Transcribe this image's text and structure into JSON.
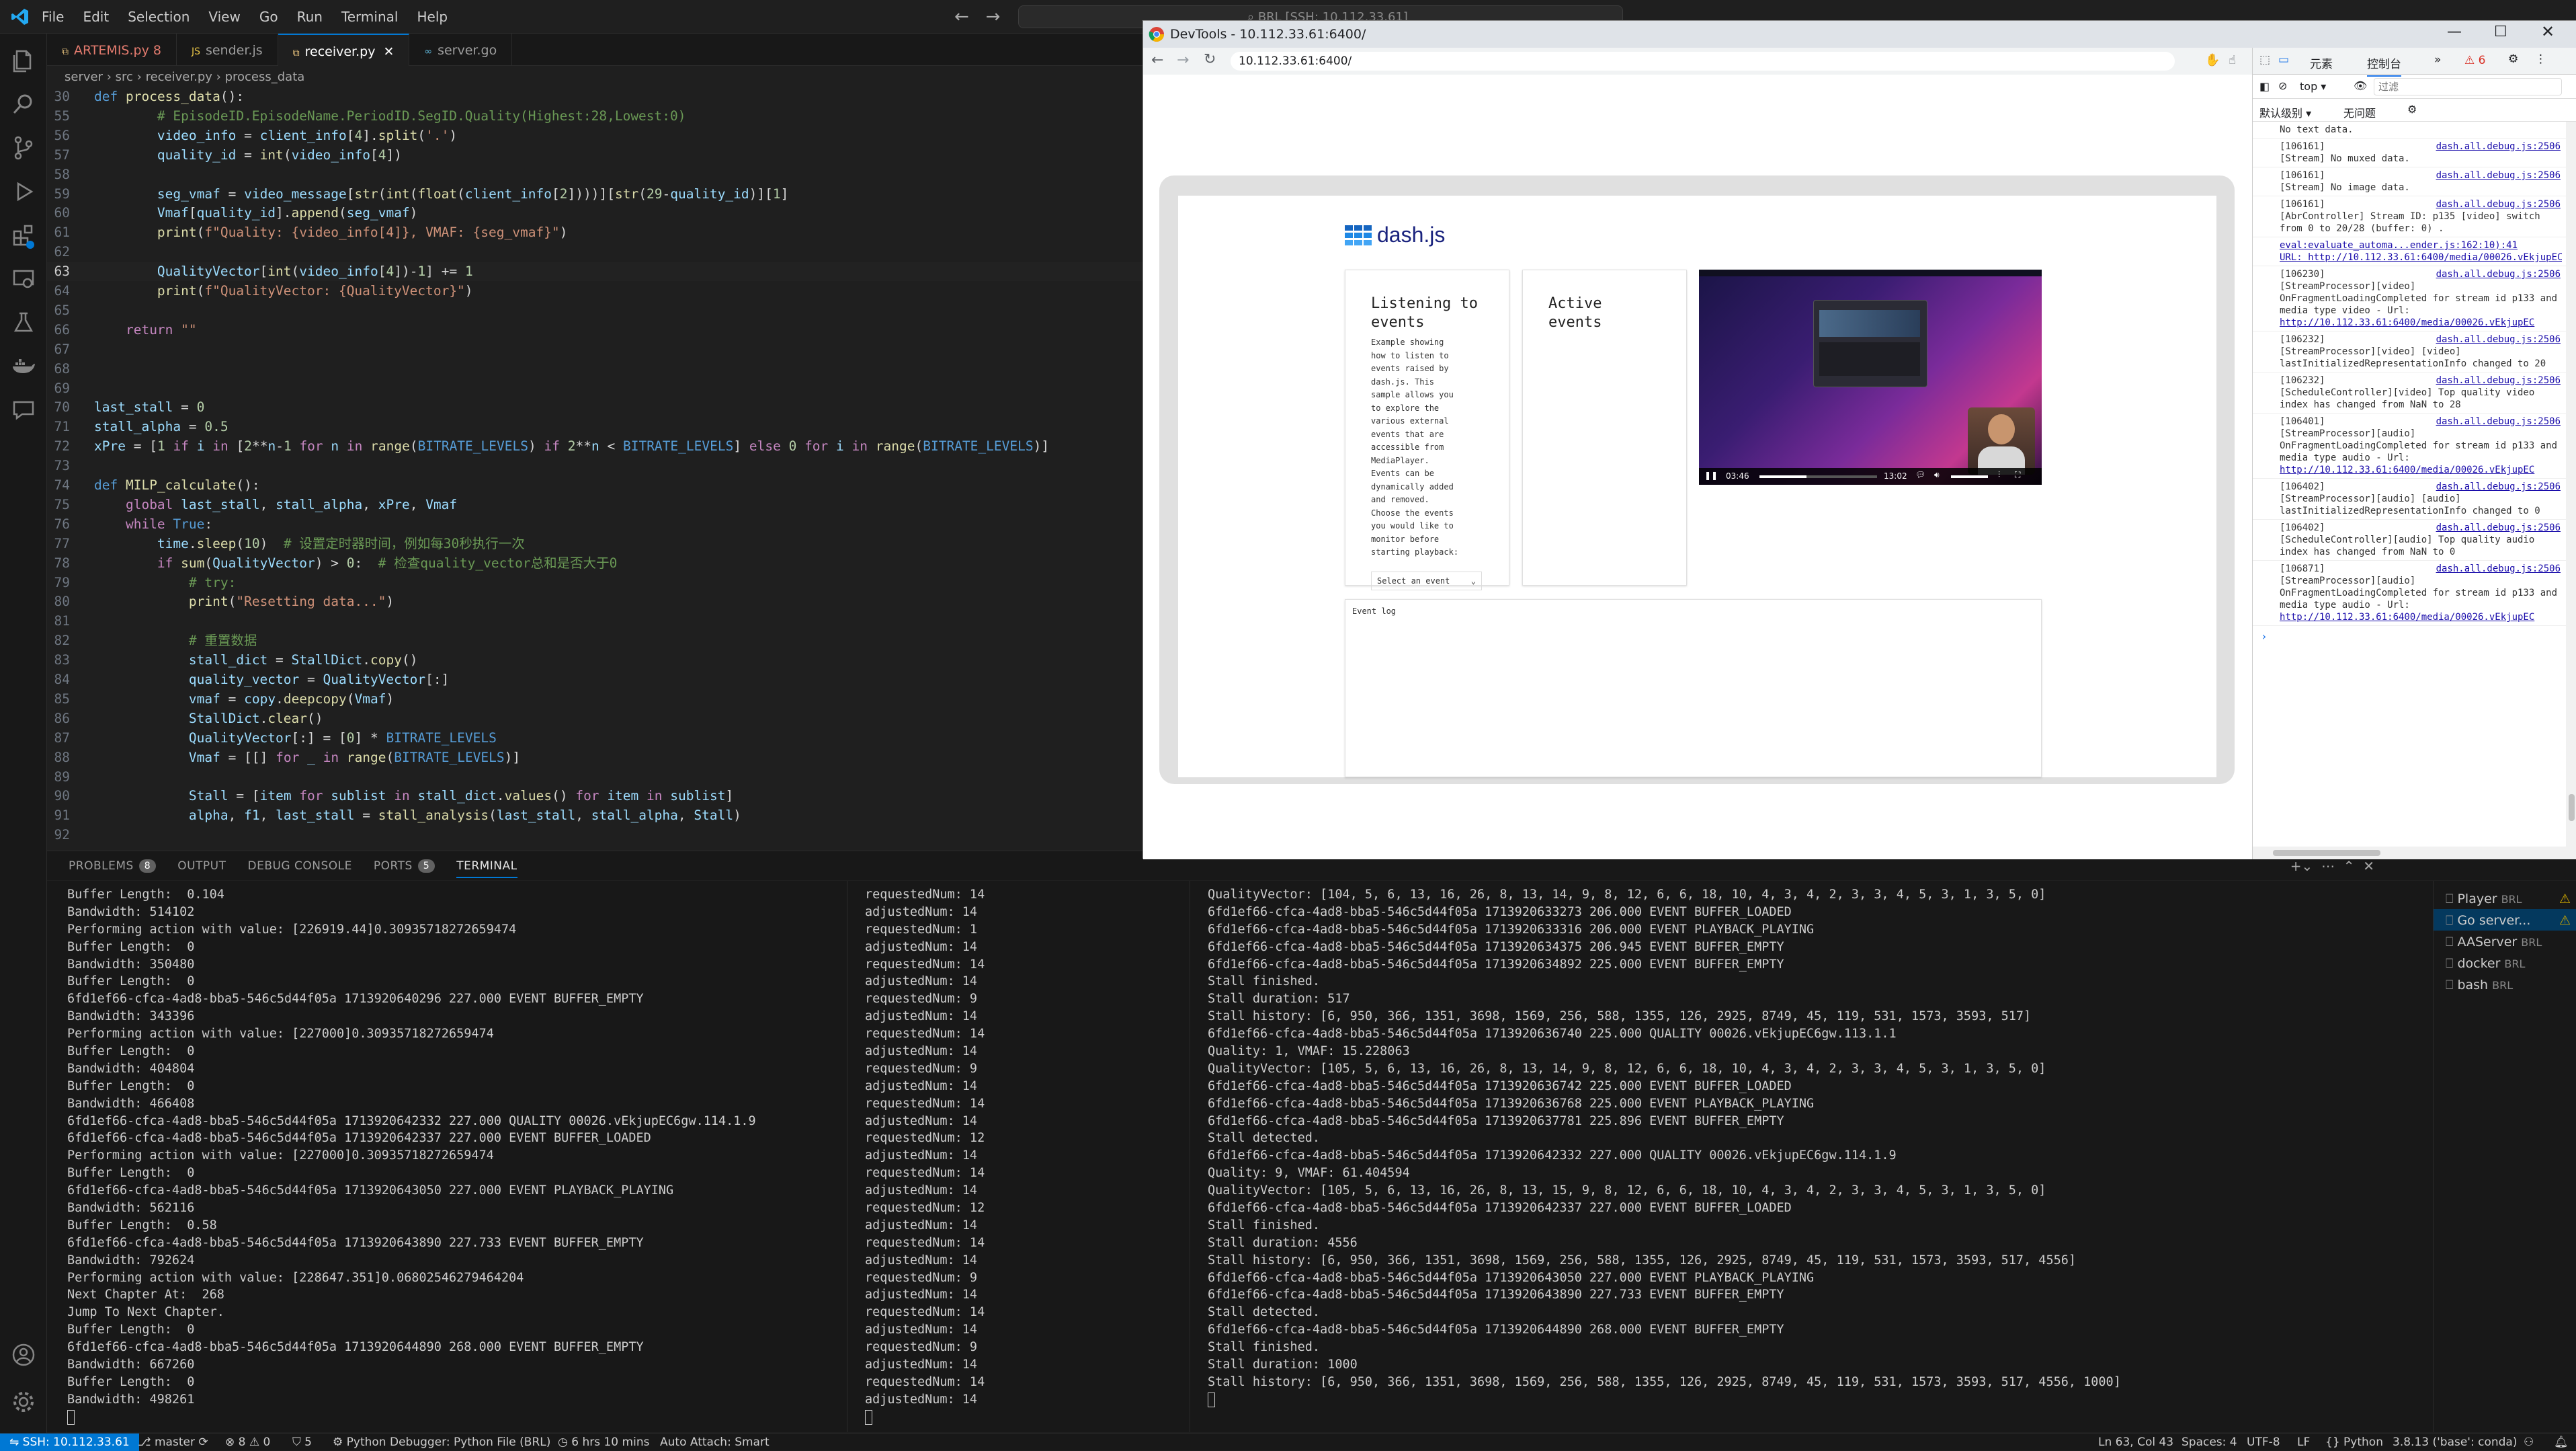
{
  "vscode": {
    "menu": [
      "File",
      "Edit",
      "Selection",
      "View",
      "Go",
      "Run",
      "Terminal",
      "Help"
    ],
    "command_center": "BRL [SSH: 10.112.33.61]",
    "tabs": [
      {
        "label": "ARTEMIS.py",
        "badge": "8",
        "icon": "python-icon"
      },
      {
        "label": "sender.js",
        "badge": "",
        "icon": "js-icon"
      },
      {
        "label": "receiver.py",
        "badge": "",
        "icon": "python-icon",
        "active": true
      },
      {
        "label": "server.go",
        "badge": "",
        "icon": "go-icon"
      }
    ],
    "breadcrumb": [
      "server",
      "src",
      "receiver.py",
      "process_data"
    ],
    "code": [
      {
        "ln": "30",
        "t": "def process_data():"
      },
      {
        "ln": "55",
        "t": "        # EpisodeID.EpisodeName.PeriodID.SegID.Quality(Highest:28,Lowest:0)"
      },
      {
        "ln": "56",
        "t": "        video_info = client_info[4].split('.')"
      },
      {
        "ln": "57",
        "t": "        quality_id = int(video_info[4])"
      },
      {
        "ln": "58",
        "t": ""
      },
      {
        "ln": "59",
        "t": "        seg_vmaf = video_message[str(int(float(client_info[2])))][str(29-quality_id)][1]"
      },
      {
        "ln": "60",
        "t": "        Vmaf[quality_id].append(seg_vmaf)"
      },
      {
        "ln": "61",
        "t": "        print(f\"Quality: {video_info[4]}, VMAF: {seg_vmaf}\")"
      },
      {
        "ln": "62",
        "t": ""
      },
      {
        "ln": "63",
        "t": "        QualityVector[int(video_info[4])-1] += 1"
      },
      {
        "ln": "64",
        "t": "        print(f\"QualityVector: {QualityVector}\")"
      },
      {
        "ln": "65",
        "t": ""
      },
      {
        "ln": "66",
        "t": "    return \"\""
      },
      {
        "ln": "67",
        "t": ""
      },
      {
        "ln": "68",
        "t": ""
      },
      {
        "ln": "69",
        "t": ""
      },
      {
        "ln": "70",
        "t": "last_stall = 0"
      },
      {
        "ln": "71",
        "t": "stall_alpha = 0.5"
      },
      {
        "ln": "72",
        "t": "xPre = [1 if i in [2**n-1 for n in range(BITRATE_LEVELS) if 2**n < BITRATE_LEVELS] else 0 for i in range(BITRATE_LEVELS)]"
      },
      {
        "ln": "73",
        "t": ""
      },
      {
        "ln": "74",
        "t": "def MILP_calculate():"
      },
      {
        "ln": "75",
        "t": "    global last_stall, stall_alpha, xPre, Vmaf"
      },
      {
        "ln": "76",
        "t": "    while True:"
      },
      {
        "ln": "77",
        "t": "        time.sleep(10)  # 设置定时器时间，例如每30秒执行一次"
      },
      {
        "ln": "78",
        "t": "        if sum(QualityVector) > 0:  # 检查quality_vector总和是否大于0"
      },
      {
        "ln": "79",
        "t": "            # try:"
      },
      {
        "ln": "80",
        "t": "            print(\"Resetting data...\")"
      },
      {
        "ln": "81",
        "t": ""
      },
      {
        "ln": "82",
        "t": "            # 重置数据"
      },
      {
        "ln": "83",
        "t": "            stall_dict = StallDict.copy()"
      },
      {
        "ln": "84",
        "t": "            quality_vector = QualityVector[:]"
      },
      {
        "ln": "85",
        "t": "            vmaf = copy.deepcopy(Vmaf)"
      },
      {
        "ln": "86",
        "t": "            StallDict.clear()"
      },
      {
        "ln": "87",
        "t": "            QualityVector[:] = [0] * BITRATE_LEVELS"
      },
      {
        "ln": "88",
        "t": "            Vmaf = [[] for _ in range(BITRATE_LEVELS)]"
      },
      {
        "ln": "89",
        "t": ""
      },
      {
        "ln": "90",
        "t": "            Stall = [item for sublist in stall_dict.values() for item in sublist]"
      },
      {
        "ln": "91",
        "t": "            alpha, f1, last_stall = stall_analysis(last_stall, stall_alpha, Stall)"
      },
      {
        "ln": "92",
        "t": ""
      }
    ],
    "cursor_line": "63",
    "panel_tabs": [
      {
        "label": "PROBLEMS",
        "count": "8"
      },
      {
        "label": "OUTPUT",
        "count": ""
      },
      {
        "label": "DEBUG CONSOLE",
        "count": ""
      },
      {
        "label": "PORTS",
        "count": "5"
      },
      {
        "label": "TERMINAL",
        "count": "",
        "active": true
      }
    ],
    "terminal1": [
      "Buffer Length:  0.104",
      "Bandwidth: 514102",
      "Performing action with value: [226919.44]0.30935718272659474",
      "Buffer Length:  0",
      "Bandwidth: 350480",
      "Buffer Length:  0",
      "6fd1ef66-cfca-4ad8-bba5-546c5d44f05a 1713920640296 227.000 EVENT BUFFER_EMPTY",
      "Bandwidth: 343396",
      "Performing action with value: [227000]0.30935718272659474",
      "Buffer Length:  0",
      "Bandwidth: 404804",
      "Buffer Length:  0",
      "Bandwidth: 466408",
      "6fd1ef66-cfca-4ad8-bba5-546c5d44f05a 1713920642332 227.000 QUALITY 00026.vEkjupEC6gw.114.1.9",
      "6fd1ef66-cfca-4ad8-bba5-546c5d44f05a 1713920642337 227.000 EVENT BUFFER_LOADED",
      "Performing action with value: [227000]0.30935718272659474",
      "Buffer Length:  0",
      "6fd1ef66-cfca-4ad8-bba5-546c5d44f05a 1713920643050 227.000 EVENT PLAYBACK_PLAYING",
      "Bandwidth: 562116",
      "Buffer Length:  0.58",
      "6fd1ef66-cfca-4ad8-bba5-546c5d44f05a 1713920643890 227.733 EVENT BUFFER_EMPTY",
      "Bandwidth: 792624",
      "Performing action with value: [228647.351]0.06802546279464204",
      "Next Chapter At:  268",
      "Jump To Next Chapter.",
      "Buffer Length:  0",
      "6fd1ef66-cfca-4ad8-bba5-546c5d44f05a 1713920644890 268.000 EVENT BUFFER_EMPTY",
      "Bandwidth: 667260",
      "Buffer Length:  0",
      "Bandwidth: 498261",
      ""
    ],
    "terminal2": [
      "requestedNum: 14",
      "adjustedNum: 14",
      "requestedNum: 1",
      "adjustedNum: 14",
      "requestedNum: 14",
      "adjustedNum: 14",
      "requestedNum: 9",
      "adjustedNum: 14",
      "requestedNum: 14",
      "adjustedNum: 14",
      "requestedNum: 9",
      "adjustedNum: 14",
      "requestedNum: 14",
      "adjustedNum: 14",
      "requestedNum: 12",
      "adjustedNum: 14",
      "requestedNum: 14",
      "adjustedNum: 14",
      "requestedNum: 12",
      "adjustedNum: 14",
      "requestedNum: 14",
      "adjustedNum: 14",
      "requestedNum: 9",
      "adjustedNum: 14",
      "requestedNum: 14",
      "adjustedNum: 14",
      "requestedNum: 9",
      "adjustedNum: 14",
      "requestedNum: 14",
      "adjustedNum: 14",
      ""
    ],
    "terminal3": [
      "QualityVector: [104, 5, 6, 13, 16, 26, 8, 13, 14, 9, 8, 12, 6, 6, 18, 10, 4, 3, 4, 2, 3, 3, 4, 5, 3, 1, 3, 5, 0]",
      "6fd1ef66-cfca-4ad8-bba5-546c5d44f05a 1713920633273 206.000 EVENT BUFFER_LOADED",
      "6fd1ef66-cfca-4ad8-bba5-546c5d44f05a 1713920633316 206.000 EVENT PLAYBACK_PLAYING",
      "6fd1ef66-cfca-4ad8-bba5-546c5d44f05a 1713920634375 206.945 EVENT BUFFER_EMPTY",
      "6fd1ef66-cfca-4ad8-bba5-546c5d44f05a 1713920634892 225.000 EVENT BUFFER_EMPTY",
      "Stall finished.",
      "Stall duration: 517",
      "Stall history: [6, 950, 366, 1351, 3698, 1569, 256, 588, 1355, 126, 2925, 8749, 45, 119, 531, 1573, 3593, 517]",
      "6fd1ef66-cfca-4ad8-bba5-546c5d44f05a 1713920636740 225.000 QUALITY 00026.vEkjupEC6gw.113.1.1",
      "Quality: 1, VMAF: 15.228063",
      "QualityVector: [105, 5, 6, 13, 16, 26, 8, 13, 14, 9, 8, 12, 6, 6, 18, 10, 4, 3, 4, 2, 3, 3, 4, 5, 3, 1, 3, 5, 0]",
      "6fd1ef66-cfca-4ad8-bba5-546c5d44f05a 1713920636742 225.000 EVENT BUFFER_LOADED",
      "6fd1ef66-cfca-4ad8-bba5-546c5d44f05a 1713920636768 225.000 EVENT PLAYBACK_PLAYING",
      "6fd1ef66-cfca-4ad8-bba5-546c5d44f05a 1713920637781 225.896 EVENT BUFFER_EMPTY",
      "Stall detected.",
      "6fd1ef66-cfca-4ad8-bba5-546c5d44f05a 1713920642332 227.000 QUALITY 00026.vEkjupEC6gw.114.1.9",
      "Quality: 9, VMAF: 61.404594",
      "QualityVector: [105, 5, 6, 13, 16, 26, 8, 13, 15, 9, 8, 12, 6, 6, 18, 10, 4, 3, 4, 2, 3, 3, 4, 5, 3, 1, 3, 5, 0]",
      "6fd1ef66-cfca-4ad8-bba5-546c5d44f05a 1713920642337 227.000 EVENT BUFFER_LOADED",
      "Stall finished.",
      "Stall duration: 4556",
      "Stall history: [6, 950, 366, 1351, 3698, 1569, 256, 588, 1355, 126, 2925, 8749, 45, 119, 531, 1573, 3593, 517, 4556]",
      "6fd1ef66-cfca-4ad8-bba5-546c5d44f05a 1713920643050 227.000 EVENT PLAYBACK_PLAYING",
      "6fd1ef66-cfca-4ad8-bba5-546c5d44f05a 1713920643890 227.733 EVENT BUFFER_EMPTY",
      "Stall detected.",
      "6fd1ef66-cfca-4ad8-bba5-546c5d44f05a 1713920644890 268.000 EVENT BUFFER_EMPTY",
      "Stall finished.",
      "Stall duration: 1000",
      "Stall history: [6, 950, 366, 1351, 3698, 1569, 256, 588, 1355, 126, 2925, 8749, 45, 119, 531, 1573, 3593, 517, 4556, 1000]",
      ""
    ],
    "terminal_list": [
      {
        "label": "Player",
        "sub": "BRL",
        "warn": true
      },
      {
        "label": "Go server...",
        "sub": "",
        "warn": true,
        "selected": true
      },
      {
        "label": "AAServer",
        "sub": "BRL",
        "warn": false
      },
      {
        "label": "docker",
        "sub": "BRL",
        "warn": false
      },
      {
        "label": "bash",
        "sub": "BRL",
        "warn": false
      }
    ],
    "status": {
      "remote": "SSH: 10.112.33.61",
      "branch": "master",
      "problems": "⊗ 8 ⚠ 0",
      "ports": "⛉ 5",
      "debugger": "Python Debugger: Python File (BRL)",
      "time": "6 hrs 10 mins",
      "autoattach": "Auto Attach: Smart",
      "position": "Ln 63, Col 43",
      "spaces": "Spaces: 4",
      "encoding": "UTF-8",
      "eol": "LF",
      "language": "{} Python",
      "interpreter": "3.8.13 ('base': conda)"
    }
  },
  "devtools": {
    "title": "DevTools - 10.112.33.61:6400/",
    "url": "10.112.33.61:6400/",
    "tabs": [
      "元素",
      "控制台"
    ],
    "warn_count": "6",
    "context": "top",
    "filter_placeholder": "过滤",
    "levels": "默认级别 ▾",
    "issues": "无问题",
    "page": {
      "logo": "dash.js",
      "listen_title": "Listening to events",
      "listen_desc": "Example showing how to listen to events raised by dash.js. This sample allows you to explore the various external events that are accessible from MediaPlayer. Events can be dynamically added and removed. Choose the events you would like to monitor before starting playback:",
      "select_label": "Select an event",
      "active_title": "Active events",
      "event_log": "Event log",
      "time_current": "03:46",
      "time_total": "13:02"
    },
    "console": [
      {
        "id": "",
        "src": "",
        "text": "No text data."
      },
      {
        "id": "[106161]",
        "src": "dash.all.debug.js:2506",
        "text": "[Stream] No muxed data."
      },
      {
        "id": "[106161]",
        "src": "dash.all.debug.js:2506",
        "text": "[Stream] No image data."
      },
      {
        "id": "[106161]",
        "src": "dash.all.debug.js:2506",
        "text": "[AbrController] Stream ID: p135 [video] switch from 0 to 20/28 (buffer: 0) ."
      },
      {
        "id": "",
        "src": "",
        "text": "",
        "link": "eval:evaluate_automa...ender.js:162:10):41",
        "url": "URL: http://10.112.33.61:6400/media/00026.vEkjupEC"
      },
      {
        "id": "[106230]",
        "src": "dash.all.debug.js:2506",
        "text": "[StreamProcessor][video] OnFragmentLoadingCompleted for stream id p133 and media type video - Url:",
        "url": "http://10.112.33.61:6400/media/00026.vEkjupEC"
      },
      {
        "id": "[106232]",
        "src": "dash.all.debug.js:2506",
        "text": "[StreamProcessor][video] [video] lastInitializedRepresentationInfo changed to 20"
      },
      {
        "id": "[106232]",
        "src": "dash.all.debug.js:2506",
        "text": "[ScheduleController][video] Top quality video index has changed from NaN to 28"
      },
      {
        "id": "[106401]",
        "src": "dash.all.debug.js:2506",
        "text": "[StreamProcessor][audio] OnFragmentLoadingCompleted for stream id p133 and media type audio - Url:",
        "url": "http://10.112.33.61:6400/media/00026.vEkjupEC"
      },
      {
        "id": "[106402]",
        "src": "dash.all.debug.js:2506",
        "text": "[StreamProcessor][audio] [audio] lastInitializedRepresentationInfo changed to 0"
      },
      {
        "id": "[106402]",
        "src": "dash.all.debug.js:2506",
        "text": "[ScheduleController][audio] Top quality audio index has changed from NaN to 0"
      },
      {
        "id": "[106871]",
        "src": "dash.all.debug.js:2506",
        "text": "[StreamProcessor][audio] OnFragmentLoadingCompleted for stream id p133 and media type audio - Url:",
        "url": "http://10.112.33.61:6400/media/00026.vEkjupEC"
      }
    ]
  }
}
